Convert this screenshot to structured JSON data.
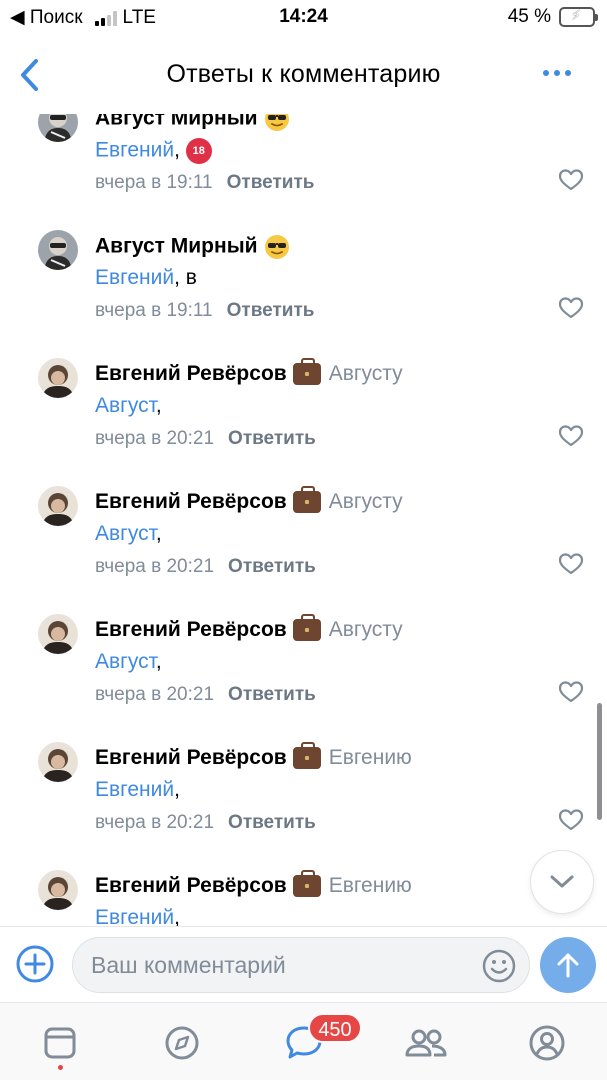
{
  "status_bar": {
    "back_label": "◀ Поиск",
    "network": "LTE",
    "time": "14:24",
    "battery_percent": "45 %",
    "battery_level": 0.45
  },
  "nav": {
    "title": "Ответы к комментарию",
    "back_icon": "chevron-left-icon",
    "more_icon": "more-horizontal-icon"
  },
  "comments": [
    {
      "author": "Август Мирный",
      "badge": "sunglasses",
      "reply_to": "",
      "mention": "Евгений",
      "text": ",",
      "extra": "18",
      "time": "вчера в 19:11",
      "reply_label": "Ответить"
    },
    {
      "author": "Август Мирный",
      "badge": "sunglasses",
      "reply_to": "",
      "mention": "Евгений",
      "text": ", в",
      "extra": "",
      "time": "вчера в 19:11",
      "reply_label": "Ответить"
    },
    {
      "author": "Евгений Ревёрсов",
      "badge": "briefcase",
      "reply_to": "Августу",
      "mention": "Август",
      "text": ",",
      "time": "вчера в 20:21",
      "reply_label": "Ответить"
    },
    {
      "author": "Евгений Ревёрсов",
      "badge": "briefcase",
      "reply_to": "Августу",
      "mention": "Август",
      "text": ",",
      "time": "вчера в 20:21",
      "reply_label": "Ответить"
    },
    {
      "author": "Евгений Ревёрсов",
      "badge": "briefcase",
      "reply_to": "Августу",
      "mention": "Август",
      "text": ",",
      "time": "вчера в 20:21",
      "reply_label": "Ответить"
    },
    {
      "author": "Евгений Ревёрсов",
      "badge": "briefcase",
      "reply_to": "Евгению",
      "mention": "Евгений",
      "text": ",",
      "time": "вчера в 20:21",
      "reply_label": "Ответить"
    },
    {
      "author": "Евгений Ревёрсов",
      "badge": "briefcase",
      "reply_to": "Евгению",
      "mention": "Евгений",
      "text": ",",
      "time": "",
      "reply_label": ""
    }
  ],
  "composer": {
    "placeholder": "Ваш комментарий",
    "add_icon": "plus-circle-icon",
    "emoji_icon": "smile-icon",
    "send_icon": "arrow-up-icon"
  },
  "tab_bar": {
    "items": [
      "newsfeed-icon",
      "discover-icon",
      "messages-icon",
      "friends-icon",
      "profile-icon"
    ],
    "messages_badge": "450"
  },
  "colors": {
    "accent": "#3f8ae0",
    "secondary_text": "#818c99",
    "badge_red": "#e64646"
  }
}
